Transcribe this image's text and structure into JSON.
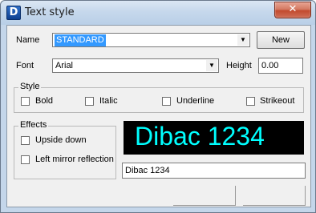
{
  "window": {
    "title": "Text style",
    "app_icon_letter": "D",
    "close_glyph": "✕"
  },
  "form": {
    "name_label": "Name",
    "name_value": "STANDARD",
    "new_button": "New",
    "font_label": "Font",
    "font_value": "Arial",
    "height_label": "Height",
    "height_value": "0.00"
  },
  "style_group": {
    "legend": "Style",
    "bold": "Bold",
    "italic": "Italic",
    "underline": "Underline",
    "strikeout": "Strikeout"
  },
  "effects_group": {
    "legend": "Effects",
    "upside_down": "Upside down",
    "left_mirror": "Left mirror reflection"
  },
  "preview": {
    "sample_text": "Dibac 1234",
    "input_value": "Dibac 1234",
    "background": "#000000",
    "text_color": "#00ffff"
  },
  "colors": {
    "selection": "#3399ff",
    "close_button": "#c24a2e"
  }
}
